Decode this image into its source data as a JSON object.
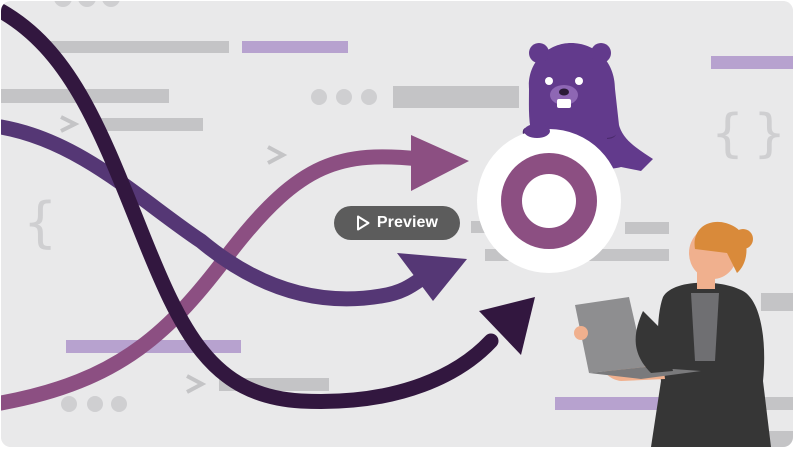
{
  "course_card": {
    "preview_label": "Preview",
    "preview_icon": "play-outline-icon"
  },
  "colors": {
    "background": "#e9e9ea",
    "code_line_gray": "#c4c4c6",
    "code_line_purple": "#b7a2cf",
    "dark_plum": "#32173f",
    "mid_purple": "#553775",
    "mauve": "#8c4f82",
    "beaver": "#623a8c",
    "person_hair": "#d98a3a",
    "person_jacket": "#363636",
    "laptop": "#8e8e90",
    "overlay_button": "#484848"
  }
}
